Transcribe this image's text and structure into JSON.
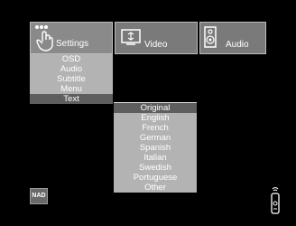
{
  "tabs": [
    {
      "id": "settings",
      "label": "Settings",
      "icon": "hand-pointer-icon",
      "active": true
    },
    {
      "id": "video",
      "label": "Video",
      "icon": "monitor-icon",
      "active": false
    },
    {
      "id": "audio",
      "label": "Audio",
      "icon": "speaker-icon",
      "active": false
    }
  ],
  "settings_menu": {
    "items": [
      "OSD",
      "Audio",
      "Subtitle",
      "Menu",
      "Text"
    ],
    "selected": "Text"
  },
  "text_submenu": {
    "items": [
      "Original",
      "English",
      "French",
      "German",
      "Spanish",
      "Italian",
      "Swedish",
      "Portuguese",
      "Other"
    ],
    "selected": "Original"
  },
  "logo": "NAD",
  "colors": {
    "background": "#000000",
    "tab": "#7a7a7a",
    "menu": "#b3b3b3",
    "selected": "#5e5e5e"
  }
}
